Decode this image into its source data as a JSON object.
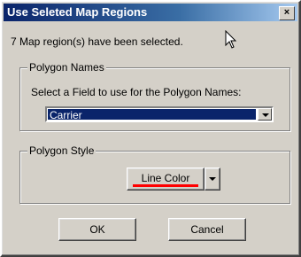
{
  "window": {
    "title": "Use Seleted Map Regions",
    "close_symbol": "×"
  },
  "info": {
    "text": "7 Map region(s) have been selected."
  },
  "polygon_names": {
    "legend": "Polygon Names",
    "field_label": "Select a Field to use for the Polygon Names:",
    "selected_value": "Carrier"
  },
  "polygon_style": {
    "legend": "Polygon Style",
    "line_color_label": "Line Color",
    "line_color": "#ff0000"
  },
  "buttons": {
    "ok": "OK",
    "cancel": "Cancel"
  }
}
